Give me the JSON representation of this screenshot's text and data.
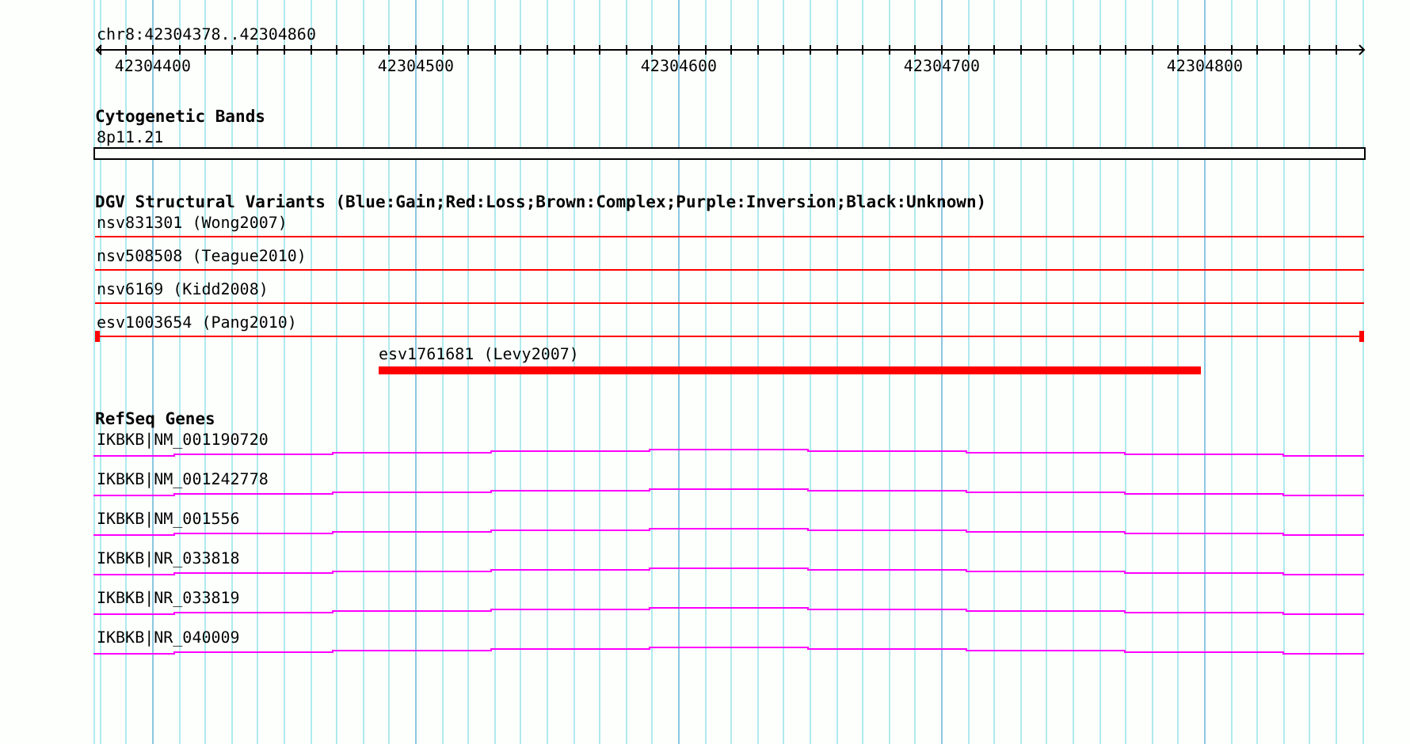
{
  "ruler": {
    "label": "chr8:42304378..42304860",
    "tick_labels": [
      "42304400",
      "42304500",
      "42304600",
      "42304700",
      "42304800"
    ]
  },
  "cytogenetic_bands": {
    "title": "Cytogenetic Bands",
    "bands": [
      {
        "label": "8p11.21"
      }
    ]
  },
  "dgv_structural_variants": {
    "title": "DGV Structural Variants (Blue:Gain;Red:Loss;Brown:Complex;Purple:Inversion;Black:Unknown)",
    "variants": [
      {
        "label": "nsv831301 (Wong2007)",
        "color": "#ff0000"
      },
      {
        "label": "nsv508508 (Teague2010)",
        "color": "#ff0000"
      },
      {
        "label": "nsv6169 (Kidd2008)",
        "color": "#ff0000"
      },
      {
        "label": "esv1003654 (Pang2010)",
        "color": "#ff0000"
      },
      {
        "label": "esv1761681 (Levy2007)",
        "color": "#ff0000"
      }
    ]
  },
  "refseq_genes": {
    "title": "RefSeq Genes",
    "genes": [
      {
        "label": "IKBKB|NM_001190720"
      },
      {
        "label": "IKBKB|NM_001242778"
      },
      {
        "label": "IKBKB|NM_001556"
      },
      {
        "label": "IKBKB|NR_033818"
      },
      {
        "label": "IKBKB|NR_033819"
      },
      {
        "label": "IKBKB|NR_040009"
      }
    ]
  }
}
